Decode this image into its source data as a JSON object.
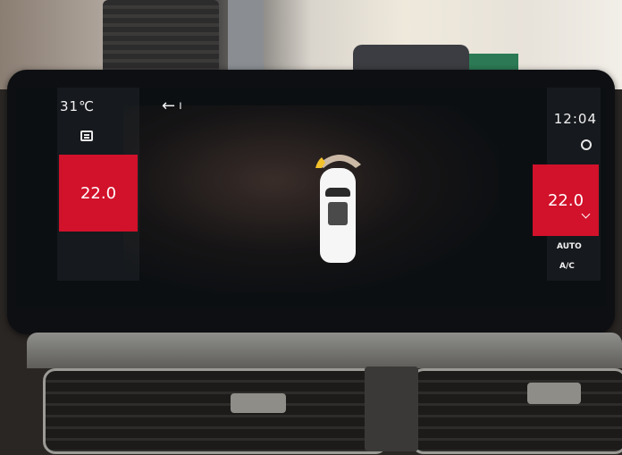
{
  "status": {
    "outside_temp": "31℃",
    "back_label": "←",
    "back_extra": "ı",
    "clock": "12:04"
  },
  "climate": {
    "left_temp": "22.0",
    "right_temp": "22.0",
    "auto_label": "AUTO",
    "ac_label": "A/C"
  },
  "icons": {
    "defrost": "rear-defrost-icon",
    "fan": "fan-icon",
    "sensor": "parking-sensor-icon"
  },
  "colors": {
    "temp_box": "#d2112a",
    "sensor_active": "#f3c12a",
    "sensor_inactive": "#cbb9a6"
  }
}
